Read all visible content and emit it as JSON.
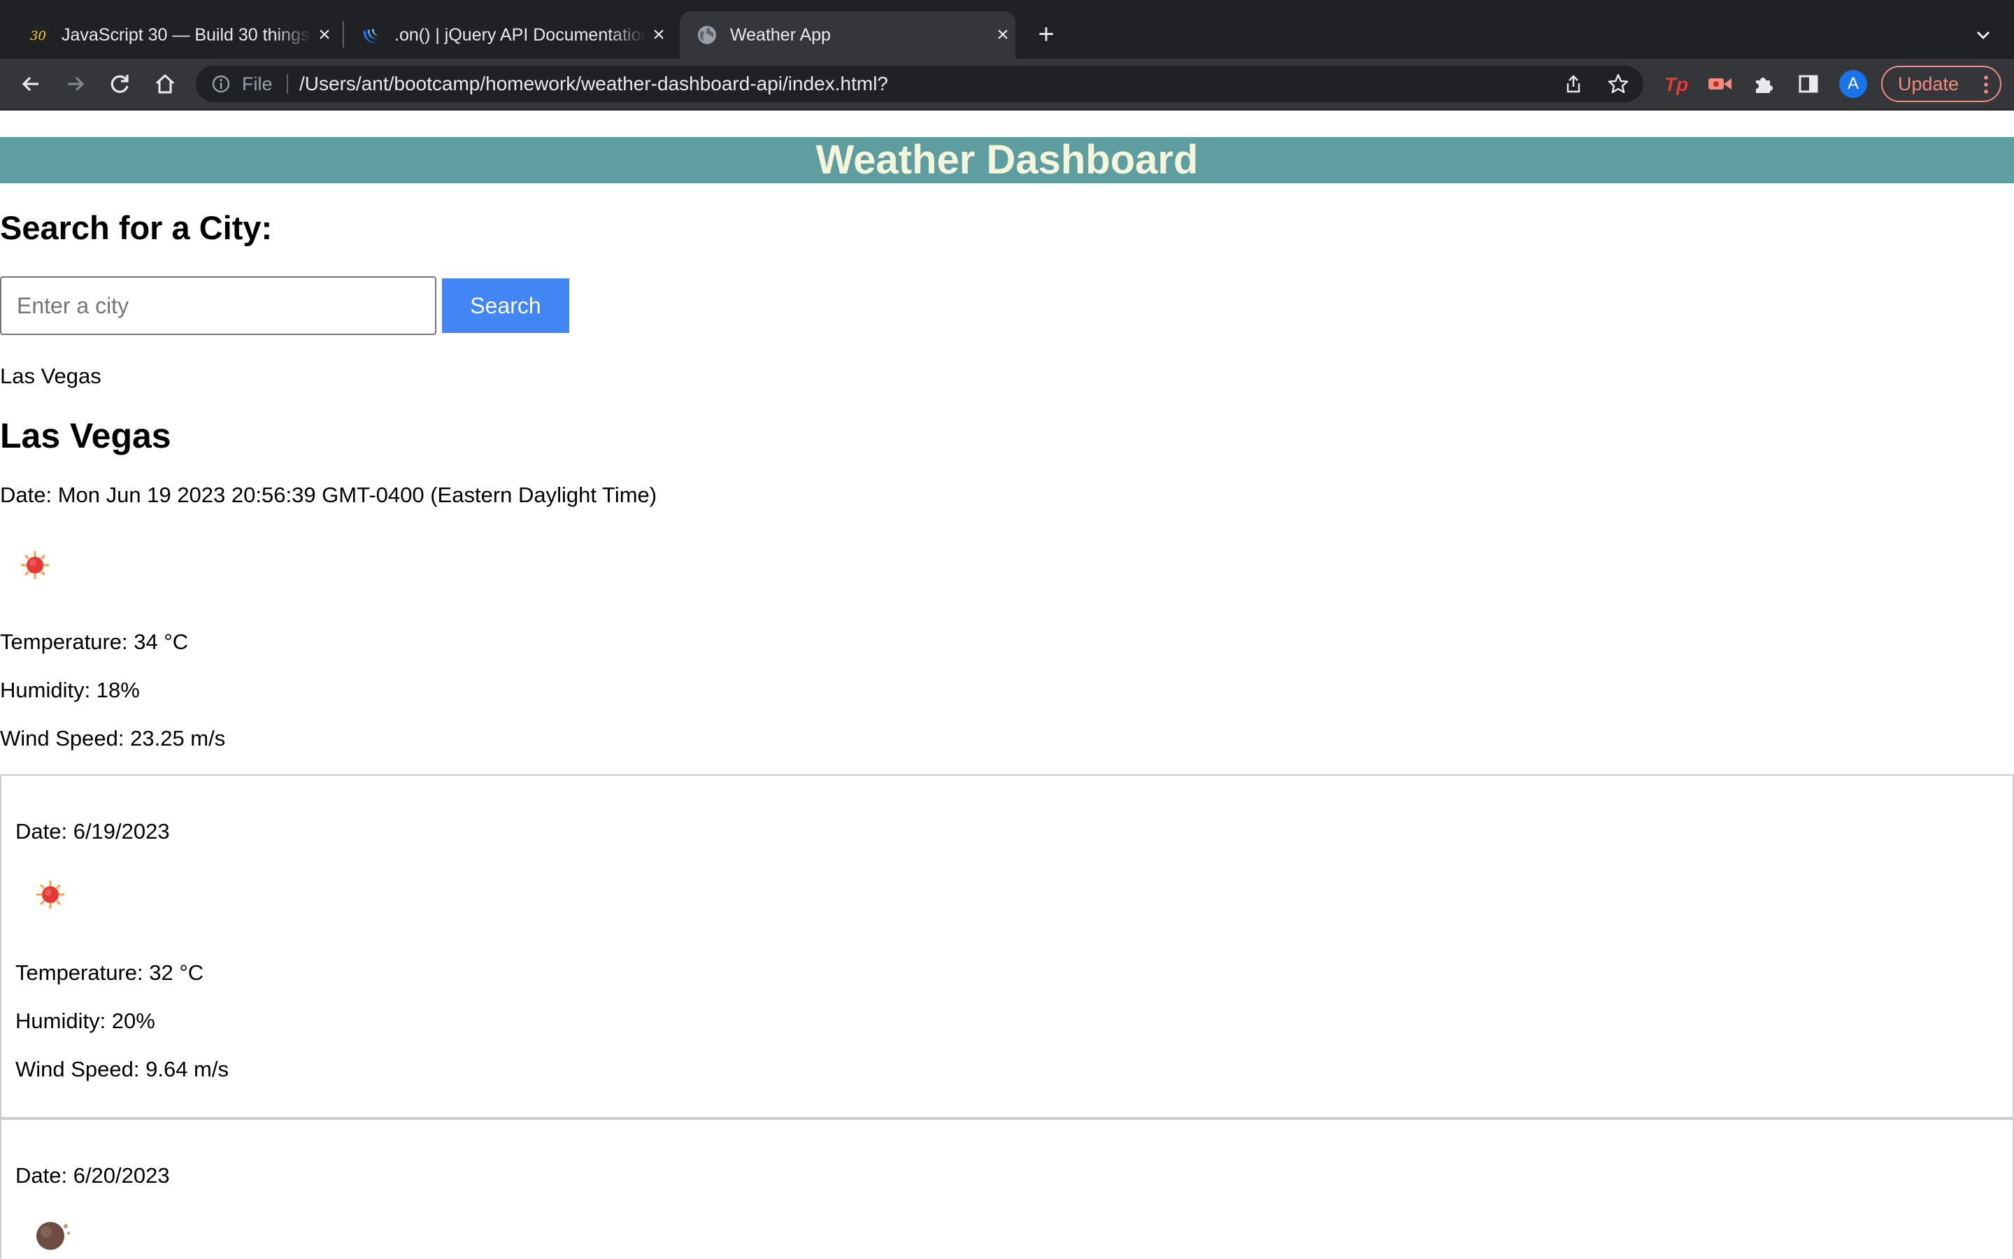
{
  "browser": {
    "tabs": [
      {
        "title": "JavaScript 30 — Build 30 things with vanilla JS",
        "favicon": "js30-favicon-icon"
      },
      {
        "title": ".on() | jQuery API Documentation",
        "favicon": "jquery-favicon-icon"
      },
      {
        "title": "Weather App",
        "favicon": "globe-icon",
        "active": true
      }
    ],
    "address_bar": {
      "scheme_label": "File",
      "url": "/Users/ant/bootcamp/homework/weather-dashboard-api/index.html?"
    },
    "profile_initial": "A",
    "update_label": "Update"
  },
  "page": {
    "header_title": "Weather Dashboard",
    "search": {
      "heading": "Search for a City:",
      "placeholder": "Enter a city",
      "button_label": "Search"
    },
    "search_history": [
      "Las Vegas"
    ],
    "current": {
      "city": "Las Vegas",
      "date": "Date: Mon Jun 19 2023 20:56:39 GMT-0400 (Eastern Daylight Time)",
      "icon": "sun-icon",
      "temperature": "Temperature: 34 °C",
      "humidity": "Humidity: 18%",
      "wind": "Wind Speed: 23.25 m/s"
    },
    "forecast": [
      {
        "date": "Date: 6/19/2023",
        "icon": "sun-icon",
        "temperature": "Temperature: 32 °C",
        "humidity": "Humidity: 20%",
        "wind": "Wind Speed: 9.64 m/s"
      },
      {
        "date": "Date: 6/20/2023",
        "icon": "moon-icon"
      }
    ]
  },
  "colors": {
    "header_bg": "#5f9ea0",
    "header_text": "#f5f5dc",
    "search_button": "#4285f4",
    "sun": "#e53935",
    "update_accent": "#f28b82"
  }
}
